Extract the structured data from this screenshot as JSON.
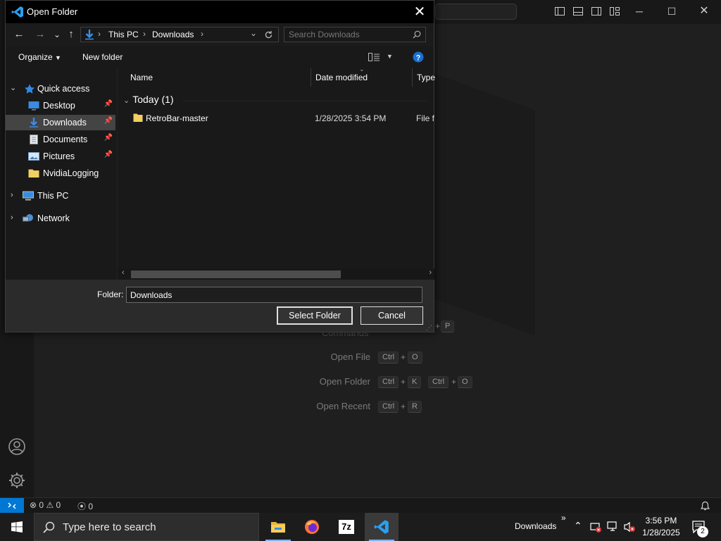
{
  "dialog": {
    "title": "Open Folder",
    "close_glyph": "✕",
    "nav": {
      "back": "←",
      "forward": "→",
      "recent": "⌄",
      "up": "↑"
    },
    "breadcrumbs": [
      "This PC",
      "Downloads"
    ],
    "search_placeholder": "Search Downloads",
    "commands": {
      "organize": "Organize",
      "new_folder": "New folder"
    },
    "sidebar": {
      "quick_access": "Quick access",
      "items": [
        {
          "label": "Desktop",
          "pinned": true
        },
        {
          "label": "Downloads",
          "pinned": true,
          "selected": true
        },
        {
          "label": "Documents",
          "pinned": true
        },
        {
          "label": "Pictures",
          "pinned": true
        },
        {
          "label": "NvidiaLogging",
          "pinned": false
        }
      ],
      "this_pc": "This PC",
      "network": "Network"
    },
    "columns": {
      "name": "Name",
      "date_modified": "Date modified",
      "type": "Type"
    },
    "group_header": "Today (1)",
    "files": [
      {
        "name": "RetroBar-master",
        "date": "1/28/2025 3:54 PM",
        "type": "File fo"
      }
    ],
    "folder_label": "Folder:",
    "folder_value": "Downloads",
    "select_button": "Select Folder",
    "cancel_button": "Cancel"
  },
  "welcome": {
    "commands_label": "Commands",
    "rows": [
      {
        "label": "Open File",
        "keys": [
          "Ctrl",
          "O"
        ]
      },
      {
        "label": "Open Folder",
        "keys": [
          "Ctrl",
          "K",
          "Ctrl",
          "O"
        ]
      },
      {
        "label": "Open Recent",
        "keys": [
          "Ctrl",
          "R"
        ]
      }
    ],
    "partial_key": "P",
    "plus": "+"
  },
  "statusbar": {
    "remote": "><",
    "errors": "0",
    "warnings": "0",
    "ports": "0"
  },
  "taskbar": {
    "search_text": "Type here to search",
    "downloads_label": "Downloads",
    "overflow": "»",
    "time": "3:56 PM",
    "date": "1/28/2025",
    "notif_count": "2",
    "sevenzip_label": "7z"
  },
  "colors": {
    "accent": "#0078d4",
    "folder_yellow": "#f2cf62",
    "selection": "#444444"
  }
}
